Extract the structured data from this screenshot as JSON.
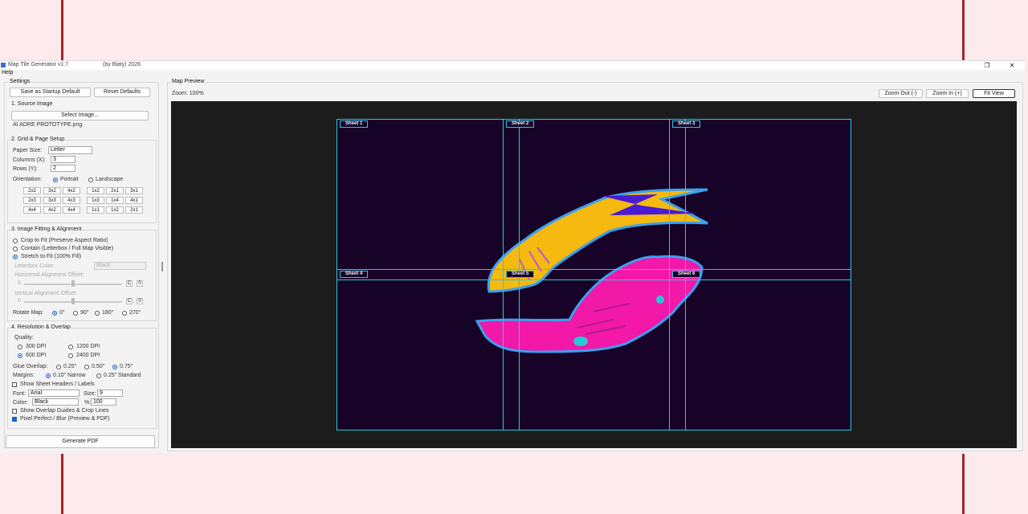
{
  "window": {
    "title": "Map Tile Generator v1.7",
    "author": "(by Blaty) 2026",
    "menu": [
      "Help"
    ],
    "controls": {
      "restore_icon": "restore-icon",
      "close_icon": "close-icon"
    }
  },
  "settings": {
    "group_label": "Settings",
    "save_default_label": "Save as Startup Default",
    "reset_label": "Reset Defaults"
  },
  "source": {
    "title": "1. Source Image",
    "select_label": "Select Image...",
    "file_name": "AI ADRE PROTOTYPE.png"
  },
  "grid": {
    "title": "2. Grid & Page Setup",
    "paper_label": "Paper Size:",
    "paper_value": "Letter",
    "cols_label": "Columns (X):",
    "cols_value": "3",
    "rows_label": "Rows (Y):",
    "rows_value": "2",
    "orientation_label": "Orientation:",
    "portrait": "Portrait",
    "landscape": "Landscape",
    "presets_left": [
      "2x2",
      "3x2",
      "4x2",
      "2x3",
      "3x3",
      "4x3",
      "4x4",
      "4x2",
      "4x4"
    ],
    "presets_right": [
      "1x2",
      "2x1",
      "3x1",
      "1x3",
      "1x4",
      "4x1",
      "1x1",
      "1x2",
      "2x1"
    ]
  },
  "fitting": {
    "title": "3. Image Fitting & Alignment",
    "option1": "Crop to Fit (Preserve Aspect Ratio)",
    "option2": "Contain (Letterbox / Full Map Visible)",
    "option3": "Stretch to Fit (100% Fill)",
    "letterbox_label": "Letterbox Color:",
    "letterbox_value": "Black",
    "h_offset_label": "Horizontal Alignment Offset:",
    "h_offset_value": "0",
    "v_offset_label": "Vertical Alignment Offset:",
    "v_offset_value": "0",
    "rotate_label": "Rotate Map:",
    "rot0": "0°",
    "rot90": "90°",
    "rot180": "180°",
    "rot270": "270°"
  },
  "resolution": {
    "title": "4. Resolution & Overlap",
    "quality_label": "Quality:",
    "dpi300": "300 DPI",
    "dpi1200": "1200 DPI",
    "dpi600": "600 DPI",
    "dpi2400": "2400 DPI",
    "glue_label": "Glue Overlap:",
    "glue1": "0.25\"",
    "glue2": "0.50\"",
    "glue3": "0.75\"",
    "margins_label": "Margins:",
    "margin1": "0.10\" Narrow",
    "margin2": "0.25\" Standard",
    "show_headers": "Show Sheet Headers / Labels",
    "font_label": "Font:",
    "font_value": "Arial",
    "size_label": "Size:",
    "size_value": "9",
    "color_label": "Color:",
    "color_value": "Black",
    "opacity_label": "%:",
    "opacity_value": "100",
    "show_guides": "Show Overlap Guides & Crop Lines",
    "pixel_perfect": "Pixel Perfect / Blur (Preview & PDF)"
  },
  "generate_label": "Generate PDF",
  "preview": {
    "group_label": "Map Preview",
    "zoom": "Zoom: 100%",
    "zoom_out": "Zoom Out (-)",
    "zoom_in": "Zoom In (+)",
    "fit_view": "Fit View",
    "sheets": [
      "Sheet 1",
      "Sheet 2",
      "Sheet 3",
      "Sheet 4",
      "Sheet 5",
      "Sheet 6"
    ],
    "colors": {
      "guide": "#28c8e6",
      "background": "#170327",
      "canvas": "#1c1c1c"
    }
  }
}
